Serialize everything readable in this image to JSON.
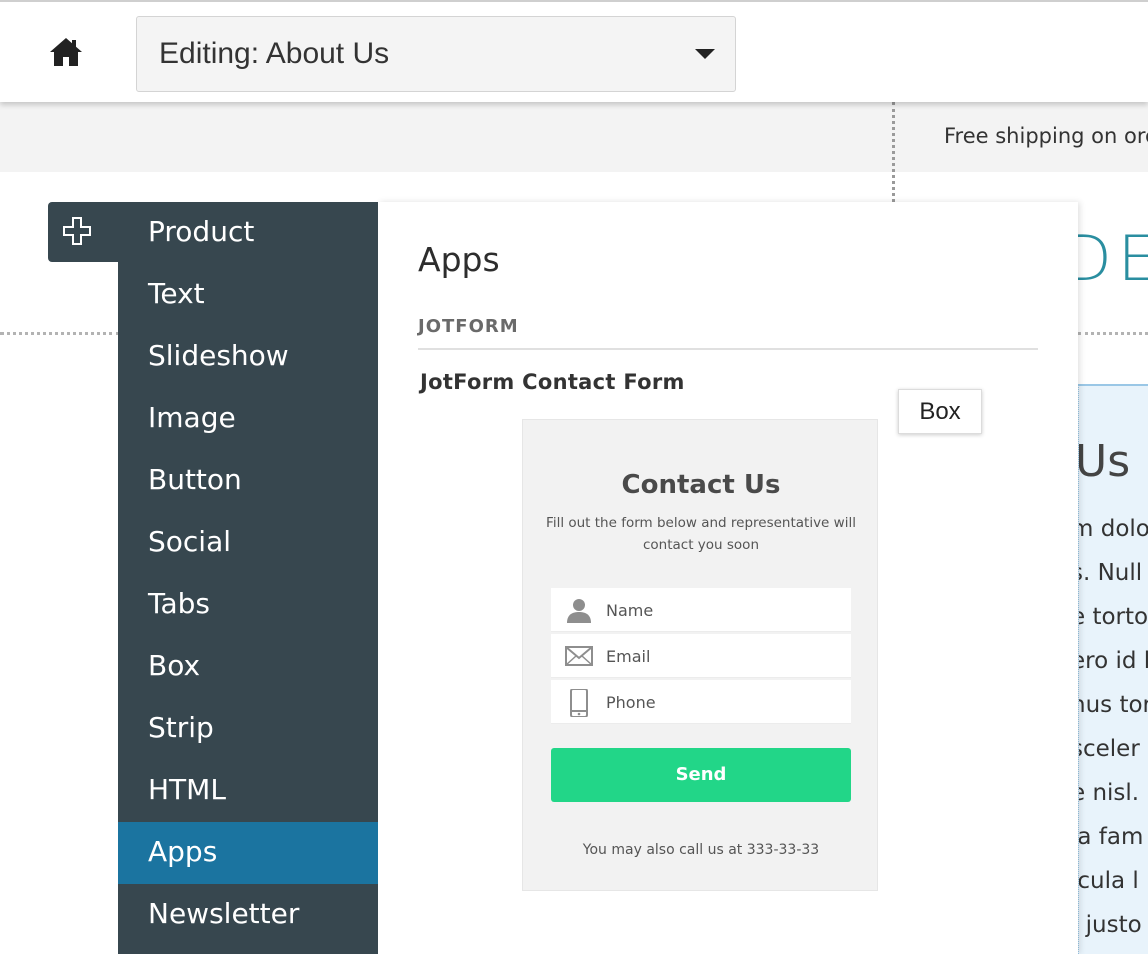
{
  "topbar": {
    "home_icon": "home-icon",
    "page_select_value": "Editing: About Us"
  },
  "site": {
    "shipping_text": "Free shipping on orc",
    "logo_fragment": "DE",
    "content_heading": "Us",
    "content_lines": [
      "m dolo",
      "s. Null",
      "e torto",
      "ero id l",
      "nus tor",
      "sceler",
      "e nisl.",
      "la fam",
      "icula l",
      ", justo"
    ]
  },
  "add_button": {
    "icon": "plus-icon"
  },
  "menu": {
    "items": [
      {
        "label": "Product"
      },
      {
        "label": "Text"
      },
      {
        "label": "Slideshow"
      },
      {
        "label": "Image"
      },
      {
        "label": "Button"
      },
      {
        "label": "Social"
      },
      {
        "label": "Tabs"
      },
      {
        "label": "Box"
      },
      {
        "label": "Strip"
      },
      {
        "label": "HTML"
      },
      {
        "label": "Apps"
      },
      {
        "label": "Newsletter"
      }
    ],
    "active_item": "Apps"
  },
  "panel": {
    "title": "Apps",
    "section_label": "JOTFORM",
    "app_name": "JotForm Contact Form",
    "form": {
      "title": "Contact Us",
      "subtitle": "Fill out the form below and representative will contact you soon",
      "fields": [
        {
          "label": "Name",
          "icon": "user-icon"
        },
        {
          "label": "Email",
          "icon": "envelope-icon"
        },
        {
          "label": "Phone",
          "icon": "phone-icon"
        }
      ],
      "send_label": "Send",
      "footer": "You may also call us at 333-33-33"
    }
  },
  "tooltip": {
    "text": "Box"
  },
  "colors": {
    "menu_bg": "#37474f",
    "menu_active": "#1b74a0",
    "send_button": "#22d688",
    "logo": "#2a8ea0"
  }
}
